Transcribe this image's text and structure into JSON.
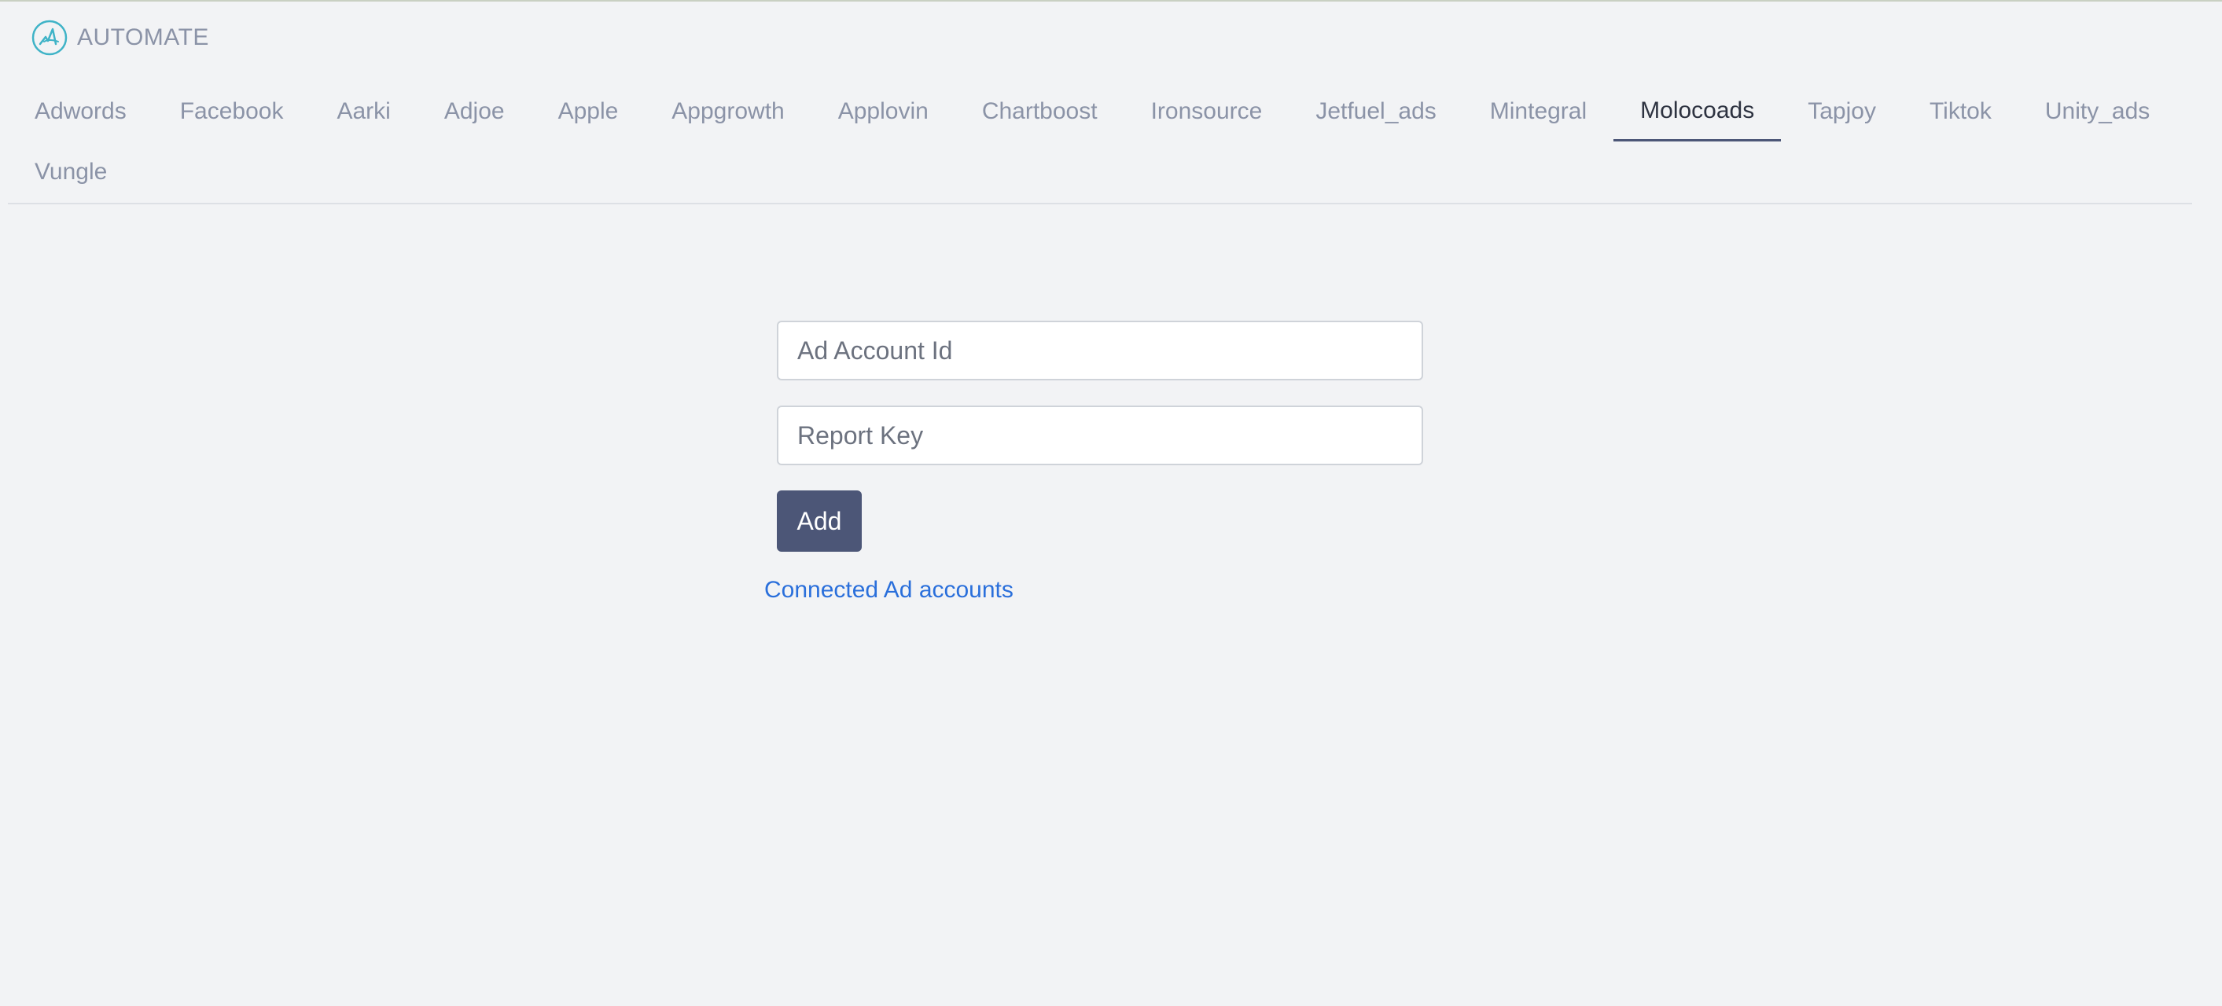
{
  "brand": {
    "name": "AUTOMATE",
    "logo_icon": "automate-logo-icon",
    "accent_color": "#3fb3c7"
  },
  "tabs": {
    "items": [
      {
        "label": "Adwords"
      },
      {
        "label": "Facebook"
      },
      {
        "label": "Aarki"
      },
      {
        "label": "Adjoe"
      },
      {
        "label": "Apple"
      },
      {
        "label": "Appgrowth"
      },
      {
        "label": "Applovin"
      },
      {
        "label": "Chartboost"
      },
      {
        "label": "Ironsource"
      },
      {
        "label": "Jetfuel_ads"
      },
      {
        "label": "Mintegral"
      },
      {
        "label": "Molocoads"
      },
      {
        "label": "Tapjoy"
      },
      {
        "label": "Tiktok"
      },
      {
        "label": "Unity_ads"
      },
      {
        "label": "Vungle"
      }
    ],
    "active": "Molocoads"
  },
  "form": {
    "ad_account_id": {
      "placeholder": "Ad Account Id",
      "value": ""
    },
    "report_key": {
      "placeholder": "Report Key",
      "value": ""
    },
    "add_label": "Add",
    "button_color": "#4c5677"
  },
  "connected_link": {
    "label": "Connected Ad accounts",
    "color": "#2a6fdb"
  }
}
